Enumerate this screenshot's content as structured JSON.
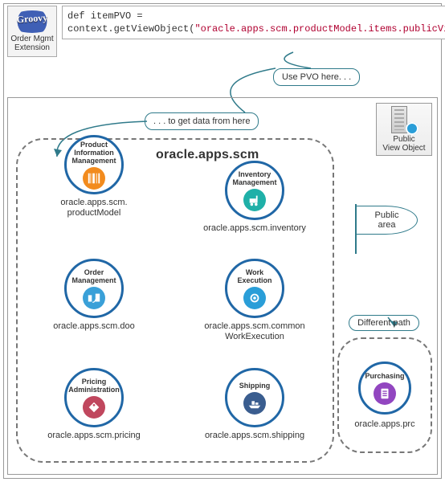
{
  "groovy": {
    "logo_text": "Groovy",
    "label_line1": "Order Mgmt",
    "label_line2": "Extension"
  },
  "code": {
    "line1_a": "def itemPVO =",
    "line2_a": "context.getViewObject(",
    "line2_str": "\"oracle.apps.scm.productModel.items.publicView.ItemPVO\"",
    "line2_b": ");"
  },
  "callouts": {
    "use_pvo": "Use PVO here. . .",
    "get_data": ". . . to get data from here"
  },
  "pvo": {
    "label_line1": "Public",
    "label_line2": "View Object"
  },
  "scm": {
    "title": "oracle.apps.scm",
    "modules": {
      "pim": {
        "title": "Product Information Management",
        "caption": "oracle.apps.scm.\nproductModel"
      },
      "inv": {
        "title": "Inventory Management",
        "caption": "oracle.apps.scm.inventory"
      },
      "om": {
        "title": "Order Management",
        "caption": "oracle.apps.scm.doo"
      },
      "we": {
        "title": "Work Execution",
        "caption": "oracle.apps.scm.common\nWorkExecution"
      },
      "pa": {
        "title": "Pricing Administration",
        "caption": "oracle.apps.scm.pricing"
      },
      "sh": {
        "title": "Shipping",
        "caption": "oracle.apps.scm.shipping"
      }
    }
  },
  "flag": {
    "line1": "Public",
    "line2": "area"
  },
  "diffpath": {
    "label": "Different  path"
  },
  "purchasing": {
    "title": "Purchasing",
    "caption": "oracle.apps.prc"
  }
}
